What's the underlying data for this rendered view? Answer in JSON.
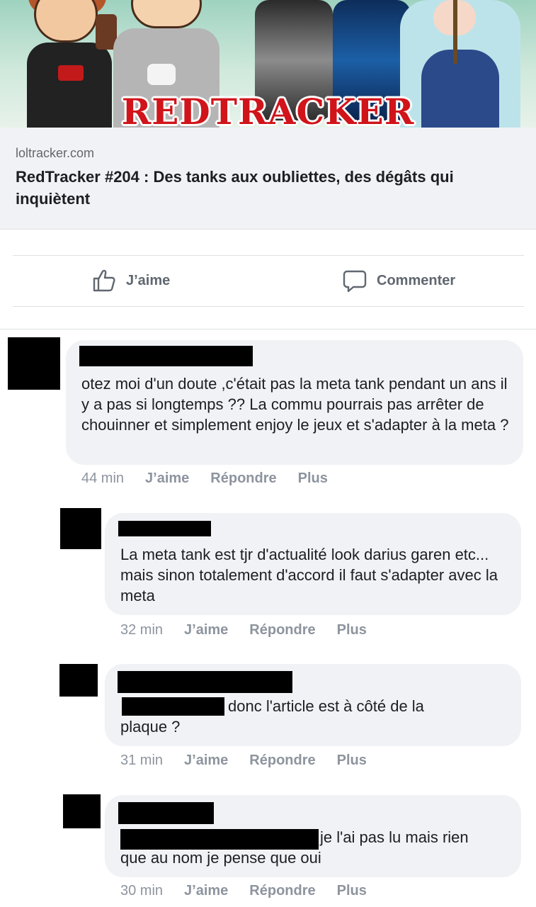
{
  "banner": {
    "title": "REDTRACKER"
  },
  "link_preview": {
    "domain": "loltracker.com",
    "title": "RedTracker #204 : Des tanks aux oubliettes, des dégâts qui inquiètent"
  },
  "actions": {
    "like_label": "J’aime",
    "comment_label": "Commenter"
  },
  "comments": [
    {
      "text": "otez moi d'un doute ,c'était pas la meta tank pendant un ans il y a pas si longtemps ?? La commu pourrais pas arrêter de chouinner et simplement enjoy le jeux et s'adapter à la meta ?",
      "time": "44 min",
      "like": "J’aime",
      "reply": "Répondre",
      "more": "Plus"
    },
    {
      "text": "La meta tank est tjr d'actualité look darius garen etc... mais sinon totalement d'accord il faut s'adapter avec la meta",
      "time": "32 min",
      "like": "J’aime",
      "reply": "Répondre",
      "more": "Plus"
    },
    {
      "text_after_tag": "donc l'article est à côté de la",
      "text_line2": "plaque ?",
      "time": "31 min",
      "like": "J’aime",
      "reply": "Répondre",
      "more": "Plus"
    },
    {
      "text_after_tag": "je l'ai pas lu mais rien",
      "text_line2": "que au nom je pense que oui",
      "time": "30 min",
      "like": "J’aime",
      "reply": "Répondre",
      "more": "Plus"
    }
  ],
  "colors": {
    "bubble": "#f0f2f5",
    "meta_text": "#8d949e",
    "action_text": "#606770",
    "brand_red": "#d0141a"
  },
  "icons": {
    "like": "thumbs-up-icon",
    "comment": "comment-bubble-icon"
  }
}
